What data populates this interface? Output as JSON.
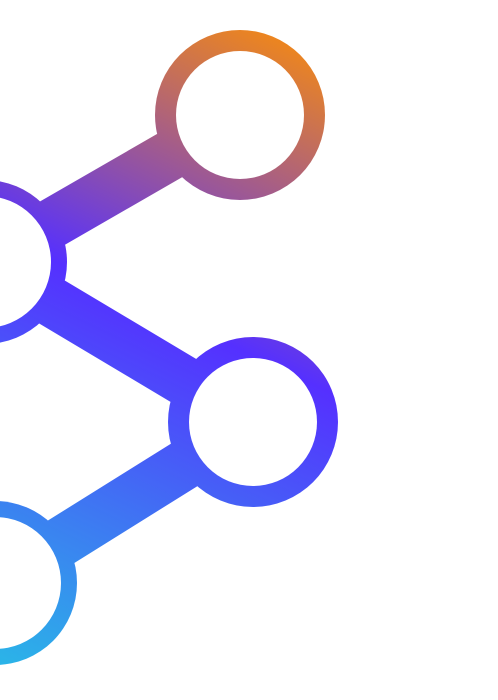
{
  "graphic": {
    "name": "connected-nodes-network-icon",
    "gradient_colors": {
      "orange": "#f58a12",
      "violet": "#5530ff",
      "cyan": "#2bb3e8"
    }
  }
}
